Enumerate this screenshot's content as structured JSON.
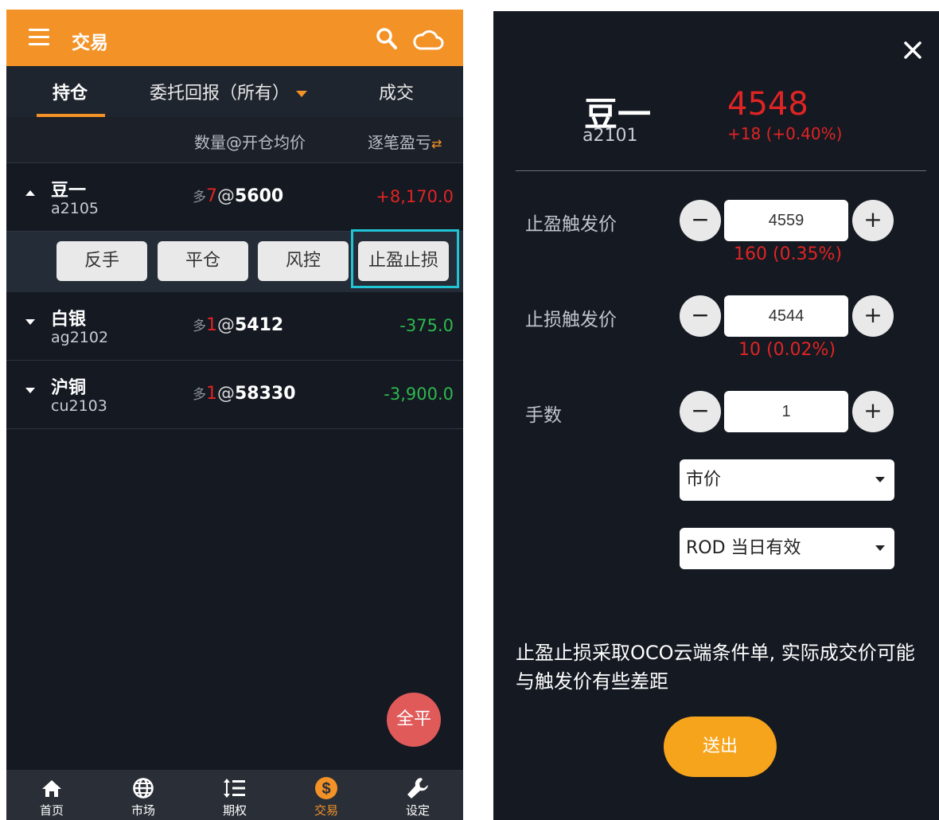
{
  "header": {
    "title": "交易",
    "search_icon": "search-icon",
    "cloud_icon": "cloud-icon"
  },
  "tabs": [
    {
      "label": "持仓"
    },
    {
      "label": "委托回报（所有）"
    },
    {
      "label": "成交"
    }
  ],
  "columns": {
    "qty_price": "数量@开仓均价",
    "pl": "逐笔盈亏"
  },
  "positions": [
    {
      "name": "豆一",
      "code": "a2105",
      "dir": "多",
      "qty": "7",
      "at": "@",
      "price": "5600",
      "pl": "+8,170.0"
    },
    {
      "name": "白银",
      "code": "ag2102",
      "dir": "多",
      "qty": "1",
      "at": "@",
      "price": "5412",
      "pl": "-375.0"
    },
    {
      "name": "沪铜",
      "code": "cu2103",
      "dir": "多",
      "qty": "1",
      "at": "@",
      "price": "58330",
      "pl": "-3,900.0"
    }
  ],
  "actions": [
    "反手",
    "平仓",
    "风控",
    "止盈止损"
  ],
  "fab_label": "全平",
  "bottom_nav": [
    {
      "label": "首页",
      "icon": "home-icon"
    },
    {
      "label": "市场",
      "icon": "globe-icon"
    },
    {
      "label": "期权",
      "icon": "list-icon"
    },
    {
      "label": "交易",
      "icon": "dollar-icon"
    },
    {
      "label": "设定",
      "icon": "wrench-icon"
    }
  ],
  "panel": {
    "name": "豆一",
    "code": "a2101",
    "price": "4548",
    "change": "+18 (+0.40%)",
    "take_profit": {
      "label": "止盈触发价",
      "value": "4559",
      "hint": "160 (0.35%)"
    },
    "stop_loss": {
      "label": "止损触发价",
      "value": "4544",
      "hint": "10 (0.02%)"
    },
    "lots": {
      "label": "手数",
      "value": "1"
    },
    "order_type": "市价",
    "validity": "ROD 当日有效",
    "minus": "−",
    "plus": "+",
    "note": "止盈止损采取OCO云端条件单, 实际成交价可能与触发价有些差距",
    "submit": "送出"
  },
  "colors": {
    "accent": "#f39227",
    "up": "#e02424",
    "down": "#2eb84d",
    "highlight": "#20c4d4"
  }
}
